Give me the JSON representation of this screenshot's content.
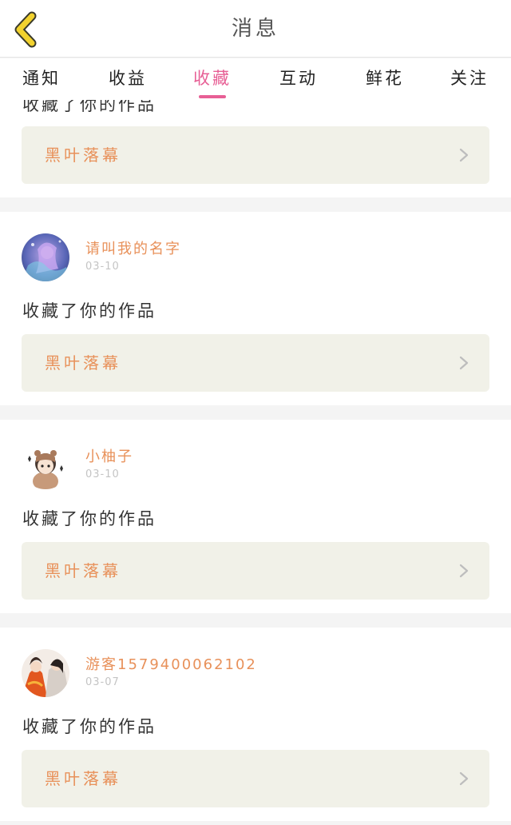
{
  "header": {
    "title": "消息"
  },
  "tabs": [
    {
      "label": "通知",
      "active": false
    },
    {
      "label": "收益",
      "active": false
    },
    {
      "label": "收藏",
      "active": true
    },
    {
      "label": "互动",
      "active": false
    },
    {
      "label": "鲜花",
      "active": false
    },
    {
      "label": "关注",
      "active": false
    }
  ],
  "top_card": {
    "action": "收藏了你的作品",
    "work": "黑叶落幕"
  },
  "messages": [
    {
      "user": "请叫我的名字",
      "date": "03-10",
      "action": "收藏了你的作品",
      "work": "黑叶落幕"
    },
    {
      "user": "小柚子",
      "date": "03-10",
      "action": "收藏了你的作品",
      "work": "黑叶落幕"
    },
    {
      "user": "游客1579400062102",
      "date": "03-07",
      "action": "收藏了你的作品",
      "work": "黑叶落幕"
    }
  ],
  "colors": {
    "accent": "#e75f95",
    "name": "#e8915a",
    "back_icon": "#f2d22e",
    "work_bg": "#f1f1e8"
  },
  "icons": {
    "back": "chevron-left-icon",
    "work_arrow": "chevron-right-icon"
  }
}
